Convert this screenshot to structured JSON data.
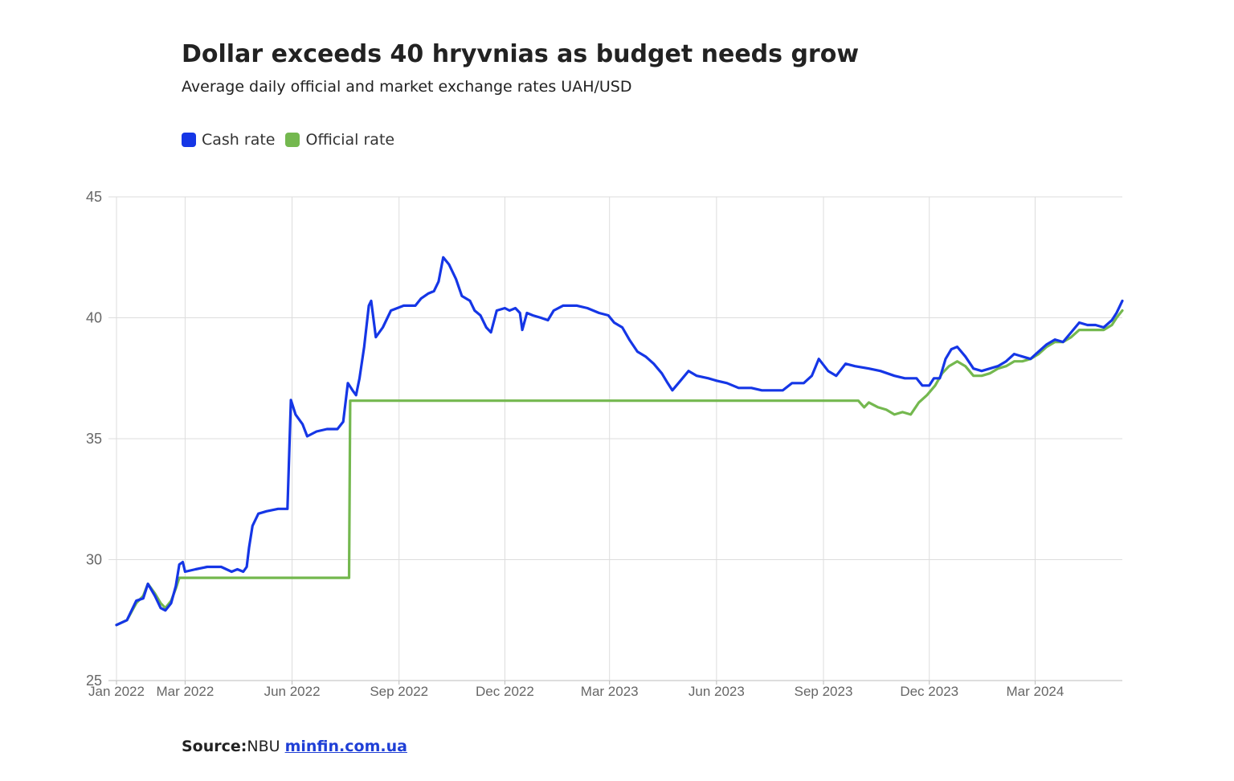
{
  "title": "Dollar exceeds 40 hryvnias as budget needs grow",
  "subtitle": "Average daily official and market exchange rates UAH/USD",
  "legend": [
    {
      "label": "Cash rate",
      "color": "#1536e6"
    },
    {
      "label": "Official rate",
      "color": "#74b84f"
    }
  ],
  "source": {
    "label": "Source:",
    "text": "NBU",
    "link": "minfin.com.ua"
  },
  "chart_data": {
    "type": "line",
    "title": "Dollar exceeds 40 hryvnias as budget needs grow",
    "subtitle": "Average daily official and market exchange rates UAH/USD",
    "xlabel": "",
    "ylabel": "",
    "x_ticks": [
      "Jan 2022",
      "Mar 2022",
      "Jun 2022",
      "Sep 2022",
      "Dec 2022",
      "Mar 2023",
      "Jun 2023",
      "Sep 2023",
      "Dec 2023",
      "Mar 2024"
    ],
    "y_ticks": [
      25,
      30,
      35,
      40,
      45
    ],
    "ylim": [
      25,
      45
    ],
    "xlim": [
      "2022-01-01",
      "2024-05-15"
    ],
    "grid": true,
    "legend_position": "top-left",
    "series": [
      {
        "name": "Cash rate",
        "color": "#1536e6",
        "points": [
          [
            "2022-01-01",
            27.3
          ],
          [
            "2022-01-10",
            27.5
          ],
          [
            "2022-01-18",
            28.3
          ],
          [
            "2022-01-24",
            28.4
          ],
          [
            "2022-01-28",
            29.0
          ],
          [
            "2022-02-03",
            28.5
          ],
          [
            "2022-02-08",
            28.0
          ],
          [
            "2022-02-12",
            27.9
          ],
          [
            "2022-02-17",
            28.2
          ],
          [
            "2022-02-21",
            28.9
          ],
          [
            "2022-02-24",
            29.8
          ],
          [
            "2022-02-27",
            29.9
          ],
          [
            "2022-03-01",
            29.5
          ],
          [
            "2022-03-10",
            29.6
          ],
          [
            "2022-03-20",
            29.7
          ],
          [
            "2022-04-01",
            29.7
          ],
          [
            "2022-04-10",
            29.5
          ],
          [
            "2022-04-15",
            29.6
          ],
          [
            "2022-04-20",
            29.5
          ],
          [
            "2022-04-23",
            29.7
          ],
          [
            "2022-04-25",
            30.5
          ],
          [
            "2022-04-28",
            31.4
          ],
          [
            "2022-05-01",
            31.7
          ],
          [
            "2022-05-03",
            31.9
          ],
          [
            "2022-05-10",
            32.0
          ],
          [
            "2022-05-20",
            32.1
          ],
          [
            "2022-05-28",
            32.1
          ],
          [
            "2022-05-31",
            36.6
          ],
          [
            "2022-06-04",
            36.0
          ],
          [
            "2022-06-10",
            35.6
          ],
          [
            "2022-06-14",
            35.1
          ],
          [
            "2022-06-22",
            35.3
          ],
          [
            "2022-07-01",
            35.4
          ],
          [
            "2022-07-10",
            35.4
          ],
          [
            "2022-07-15",
            35.7
          ],
          [
            "2022-07-19",
            37.3
          ],
          [
            "2022-07-23",
            37.0
          ],
          [
            "2022-07-26",
            36.8
          ],
          [
            "2022-07-29",
            37.5
          ],
          [
            "2022-08-02",
            38.8
          ],
          [
            "2022-08-06",
            40.5
          ],
          [
            "2022-08-08",
            40.7
          ],
          [
            "2022-08-12",
            39.2
          ],
          [
            "2022-08-18",
            39.6
          ],
          [
            "2022-08-25",
            40.3
          ],
          [
            "2022-09-05",
            40.5
          ],
          [
            "2022-09-15",
            40.5
          ],
          [
            "2022-09-20",
            40.8
          ],
          [
            "2022-09-26",
            41.0
          ],
          [
            "2022-10-01",
            41.1
          ],
          [
            "2022-10-05",
            41.5
          ],
          [
            "2022-10-09",
            42.5
          ],
          [
            "2022-10-14",
            42.2
          ],
          [
            "2022-10-20",
            41.6
          ],
          [
            "2022-10-25",
            40.9
          ],
          [
            "2022-11-01",
            40.7
          ],
          [
            "2022-11-05",
            40.3
          ],
          [
            "2022-11-10",
            40.1
          ],
          [
            "2022-11-15",
            39.6
          ],
          [
            "2022-11-19",
            39.4
          ],
          [
            "2022-11-24",
            40.3
          ],
          [
            "2022-12-01",
            40.4
          ],
          [
            "2022-12-05",
            40.3
          ],
          [
            "2022-12-10",
            40.4
          ],
          [
            "2022-12-14",
            40.2
          ],
          [
            "2022-12-16",
            39.5
          ],
          [
            "2022-12-20",
            40.2
          ],
          [
            "2022-12-25",
            40.1
          ],
          [
            "2023-01-01",
            40.0
          ],
          [
            "2023-01-07",
            39.9
          ],
          [
            "2023-01-12",
            40.3
          ],
          [
            "2023-01-20",
            40.5
          ],
          [
            "2023-02-01",
            40.5
          ],
          [
            "2023-02-10",
            40.4
          ],
          [
            "2023-02-20",
            40.2
          ],
          [
            "2023-02-28",
            40.1
          ],
          [
            "2023-03-05",
            39.8
          ],
          [
            "2023-03-12",
            39.6
          ],
          [
            "2023-03-18",
            39.1
          ],
          [
            "2023-03-25",
            38.6
          ],
          [
            "2023-04-01",
            38.4
          ],
          [
            "2023-04-08",
            38.1
          ],
          [
            "2023-04-15",
            37.7
          ],
          [
            "2023-04-20",
            37.3
          ],
          [
            "2023-04-24",
            37.0
          ],
          [
            "2023-05-01",
            37.4
          ],
          [
            "2023-05-08",
            37.8
          ],
          [
            "2023-05-15",
            37.6
          ],
          [
            "2023-05-25",
            37.5
          ],
          [
            "2023-06-01",
            37.4
          ],
          [
            "2023-06-10",
            37.3
          ],
          [
            "2023-06-20",
            37.1
          ],
          [
            "2023-07-01",
            37.1
          ],
          [
            "2023-07-10",
            37.0
          ],
          [
            "2023-07-20",
            37.0
          ],
          [
            "2023-07-28",
            37.0
          ],
          [
            "2023-08-05",
            37.3
          ],
          [
            "2023-08-15",
            37.3
          ],
          [
            "2023-08-22",
            37.6
          ],
          [
            "2023-08-28",
            38.3
          ],
          [
            "2023-09-05",
            37.8
          ],
          [
            "2023-09-12",
            37.6
          ],
          [
            "2023-09-20",
            38.1
          ],
          [
            "2023-09-28",
            38.0
          ],
          [
            "2023-10-10",
            37.9
          ],
          [
            "2023-10-20",
            37.8
          ],
          [
            "2023-11-01",
            37.6
          ],
          [
            "2023-11-10",
            37.5
          ],
          [
            "2023-11-20",
            37.5
          ],
          [
            "2023-11-25",
            37.2
          ],
          [
            "2023-12-01",
            37.2
          ],
          [
            "2023-12-05",
            37.5
          ],
          [
            "2023-12-10",
            37.5
          ],
          [
            "2023-12-15",
            38.3
          ],
          [
            "2023-12-20",
            38.7
          ],
          [
            "2023-12-25",
            38.8
          ],
          [
            "2024-01-01",
            38.4
          ],
          [
            "2024-01-08",
            37.9
          ],
          [
            "2024-01-15",
            37.8
          ],
          [
            "2024-01-22",
            37.9
          ],
          [
            "2024-01-29",
            38.0
          ],
          [
            "2024-02-05",
            38.2
          ],
          [
            "2024-02-12",
            38.5
          ],
          [
            "2024-02-19",
            38.4
          ],
          [
            "2024-02-26",
            38.3
          ],
          [
            "2024-03-04",
            38.6
          ],
          [
            "2024-03-11",
            38.9
          ],
          [
            "2024-03-18",
            39.1
          ],
          [
            "2024-03-25",
            39.0
          ],
          [
            "2024-04-01",
            39.4
          ],
          [
            "2024-04-08",
            39.8
          ],
          [
            "2024-04-15",
            39.7
          ],
          [
            "2024-04-22",
            39.7
          ],
          [
            "2024-04-29",
            39.6
          ],
          [
            "2024-05-06",
            39.9
          ],
          [
            "2024-05-10",
            40.2
          ],
          [
            "2024-05-15",
            40.7
          ]
        ]
      },
      {
        "name": "Official rate",
        "color": "#74b84f",
        "points": [
          [
            "2022-01-01",
            27.3
          ],
          [
            "2022-01-10",
            27.5
          ],
          [
            "2022-01-18",
            28.2
          ],
          [
            "2022-01-24",
            28.5
          ],
          [
            "2022-01-28",
            29.0
          ],
          [
            "2022-02-03",
            28.6
          ],
          [
            "2022-02-08",
            28.2
          ],
          [
            "2022-02-12",
            28.0
          ],
          [
            "2022-02-17",
            28.3
          ],
          [
            "2022-02-21",
            28.8
          ],
          [
            "2022-02-24",
            29.25
          ],
          [
            "2022-07-20",
            29.25
          ],
          [
            "2022-07-21",
            36.57
          ],
          [
            "2023-10-01",
            36.57
          ],
          [
            "2023-10-06",
            36.3
          ],
          [
            "2023-10-10",
            36.5
          ],
          [
            "2023-10-18",
            36.3
          ],
          [
            "2023-10-25",
            36.2
          ],
          [
            "2023-11-01",
            36.0
          ],
          [
            "2023-11-08",
            36.1
          ],
          [
            "2023-11-15",
            36.0
          ],
          [
            "2023-11-22",
            36.5
          ],
          [
            "2023-11-29",
            36.8
          ],
          [
            "2023-12-06",
            37.2
          ],
          [
            "2023-12-12",
            37.7
          ],
          [
            "2023-12-18",
            38.0
          ],
          [
            "2023-12-25",
            38.2
          ],
          [
            "2024-01-01",
            38.0
          ],
          [
            "2024-01-08",
            37.6
          ],
          [
            "2024-01-15",
            37.6
          ],
          [
            "2024-01-22",
            37.7
          ],
          [
            "2024-01-29",
            37.9
          ],
          [
            "2024-02-05",
            38.0
          ],
          [
            "2024-02-12",
            38.2
          ],
          [
            "2024-02-19",
            38.2
          ],
          [
            "2024-02-26",
            38.3
          ],
          [
            "2024-03-04",
            38.5
          ],
          [
            "2024-03-11",
            38.8
          ],
          [
            "2024-03-18",
            39.0
          ],
          [
            "2024-03-25",
            39.0
          ],
          [
            "2024-04-01",
            39.2
          ],
          [
            "2024-04-08",
            39.5
          ],
          [
            "2024-04-15",
            39.5
          ],
          [
            "2024-04-22",
            39.5
          ],
          [
            "2024-04-29",
            39.5
          ],
          [
            "2024-05-06",
            39.7
          ],
          [
            "2024-05-10",
            40.0
          ],
          [
            "2024-05-15",
            40.3
          ]
        ]
      }
    ]
  }
}
